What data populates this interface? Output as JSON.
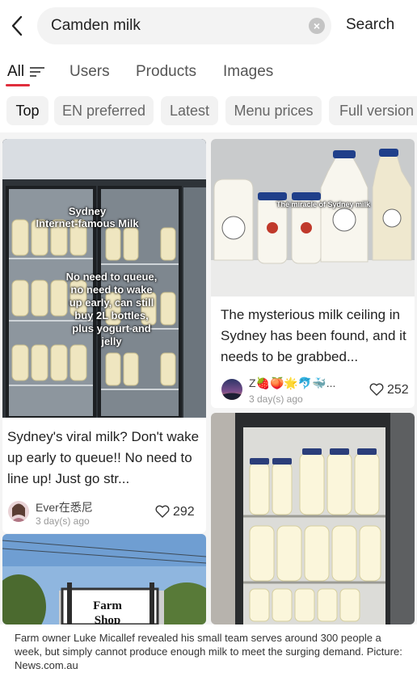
{
  "search": {
    "query": "Camden milk",
    "search_label": "Search"
  },
  "tabs": [
    {
      "label": "All"
    },
    {
      "label": "Users"
    },
    {
      "label": "Products"
    },
    {
      "label": "Images"
    }
  ],
  "chips": [
    {
      "label": "Top"
    },
    {
      "label": "EN preferred"
    },
    {
      "label": "Latest"
    },
    {
      "label": "Menu prices"
    },
    {
      "label": "Full version"
    }
  ],
  "posts": [
    {
      "image_text_top": "Sydney\nInternet-famous Milk",
      "image_text_body": "No need to queue,\nno need to wake\nup early, can still\nbuy 2L bottles,\nplus yogurt and\njelly",
      "title": "Sydney's viral milk? Don't wake up early to queue!! No need to line up! Just go str...",
      "author": "Ever在悉尼",
      "time": "3 day(s) ago",
      "likes": "292"
    },
    {
      "image_text_top": "The miracle of Sydney milk",
      "title": "The mysterious milk ceiling in Sydney has been found, and it needs to be grabbed...",
      "author": "Z🍓🍑🌟🐬🐳...",
      "time": "3 day(s) ago",
      "likes": "252"
    },
    {
      "image_text_top": "Farm\nShop"
    },
    {}
  ],
  "caption": "Farm owner Luke Micallef revealed his small team serves around 300 people a week, but simply cannot produce enough milk to meet the surging demand. Picture: News.com.au",
  "colors": {
    "accent": "#e02e3c"
  }
}
